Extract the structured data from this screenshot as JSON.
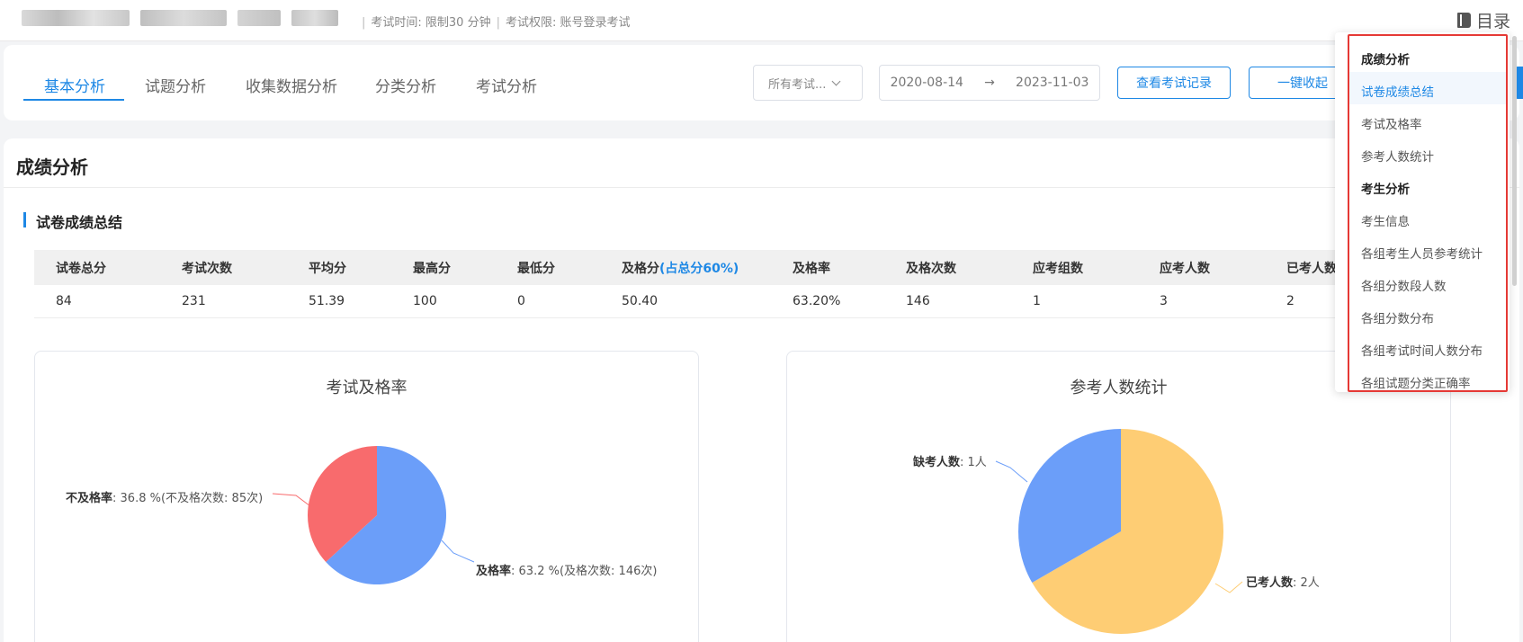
{
  "header": {
    "exam_time": "考试时间: 限制30 分钟",
    "separator": "|",
    "exam_permission": "考试权限: 账号登录考试",
    "catalog_label": "目录"
  },
  "tabs": [
    {
      "label": "基本分析",
      "active": true
    },
    {
      "label": "试题分析"
    },
    {
      "label": "收集数据分析"
    },
    {
      "label": "分类分析"
    },
    {
      "label": "考试分析"
    }
  ],
  "filters": {
    "exam_select": "所有考试...",
    "date_start": "2020-08-14",
    "date_arrow": "→",
    "date_end": "2023-11-03",
    "view_records": "查看考试记录",
    "collapse_all": "一键收起"
  },
  "section": {
    "title": "成绩分析",
    "subtitle": "试卷成绩总结"
  },
  "summary_table": {
    "headers": [
      "试卷总分",
      "考试次数",
      "平均分",
      "最高分",
      "最低分",
      "及格分",
      "及格率",
      "及格次数",
      "应考组数",
      "应考人数",
      "已考人数"
    ],
    "pass_header_note": "(占总分60%)",
    "row": [
      "84",
      "231",
      "51.39",
      "100",
      "0",
      "50.40",
      "63.20%",
      "146",
      "1",
      "3",
      "2"
    ]
  },
  "pass_chart": {
    "title": "考试及格率",
    "fail_label": "不及格率",
    "fail_text": ": 36.8 %(不及格次数: 85次)",
    "pass_label": "及格率",
    "pass_text": ": 63.2 %(及格次数: 146次)"
  },
  "attend_chart": {
    "title": "参考人数统计",
    "absent_label": "缺考人数",
    "absent_text": ": 1人",
    "attended_label": "已考人数",
    "attended_text": ": 2人"
  },
  "chart_data": [
    {
      "type": "pie",
      "title": "考试及格率",
      "slices": [
        {
          "name": "及格率",
          "value": 63.2,
          "count": 146,
          "color": "#6b9ef9"
        },
        {
          "name": "不及格率",
          "value": 36.8,
          "count": 85,
          "color": "#f86b6d"
        }
      ]
    },
    {
      "type": "pie",
      "title": "参考人数统计",
      "slices": [
        {
          "name": "已考人数",
          "value": 2,
          "color": "#fecd74"
        },
        {
          "name": "缺考人数",
          "value": 1,
          "color": "#6b9ef9"
        }
      ]
    }
  ],
  "toc": {
    "items": [
      {
        "label": "成绩分析",
        "group": true
      },
      {
        "label": "试卷成绩总结",
        "active": true
      },
      {
        "label": "考试及格率"
      },
      {
        "label": "参考人数统计"
      },
      {
        "label": "考生分析",
        "group": true
      },
      {
        "label": "考生信息"
      },
      {
        "label": "各组考生人员参考统计"
      },
      {
        "label": "各组分数段人数"
      },
      {
        "label": "各组分数分布"
      },
      {
        "label": "各组考试时间人数分布"
      },
      {
        "label": "各组试题分类正确率"
      }
    ]
  },
  "colors": {
    "accent": "#1e88e5",
    "highlight_frame": "#e53935"
  }
}
